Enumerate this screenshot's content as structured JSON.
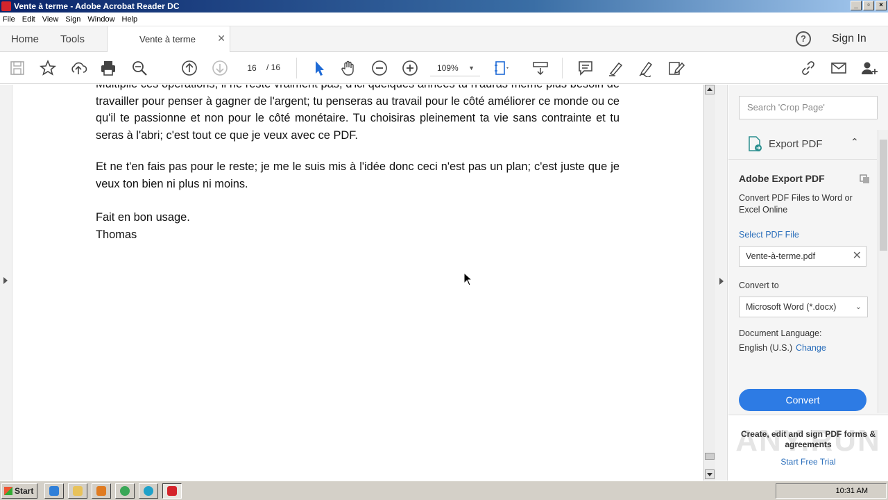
{
  "window": {
    "title": "Vente à terme - Adobe Acrobat Reader DC"
  },
  "menu": [
    "File",
    "Edit",
    "View",
    "Sign",
    "Window",
    "Help"
  ],
  "nav": {
    "home": "Home",
    "tools": "Tools",
    "doc_tab": "Vente à terme",
    "sign_in": "Sign In"
  },
  "toolbar": {
    "page_current": "16",
    "page_sep": "/ 16",
    "zoom": "109%"
  },
  "document": {
    "paragraphs": [
      "Multiplie ces opérations; il ne reste vraiment pas, d'ici quelques années tu n'auras même plus besoin de travailler pour penser à gagner de l'argent; tu penseras au travail pour le côté améliorer ce monde ou ce qu'il te passionne et non pour le côté monétaire. Tu choisiras pleinement ta vie sans contrainte et tu seras à l'abri; c'est tout ce que je veux avec ce PDF.",
      "Et ne t'en fais pas pour le reste; je me le suis mis à l'idée donc ceci n'est pas un plan; c'est juste que je veux ton bien ni plus ni moins.",
      "Fait en bon usage.",
      "Thomas"
    ]
  },
  "right_pane": {
    "search_placeholder": "Search 'Crop Page'",
    "export_label": "Export PDF",
    "panel_title": "Adobe Export PDF",
    "panel_desc": "Convert PDF Files to Word or Excel Online",
    "select_link": "Select PDF File",
    "file_name": "Vente-à-terme.pdf",
    "convert_to_label": "Convert to",
    "format": "Microsoft Word (*.docx)",
    "lang_label": "Document Language:",
    "lang_value": "English (U.S.)",
    "lang_change": "Change",
    "convert_button": "Convert",
    "promo_text": "Create, edit and sign PDF forms & agreements",
    "promo_link": "Start Free Trial",
    "watermark": "ANY.RUN"
  },
  "taskbar": {
    "start": "Start",
    "clock": "10:31 AM"
  },
  "colors": {
    "accent": "#2d7be4",
    "link": "#2a6ebb",
    "acrobat_red": "#d4242b"
  }
}
